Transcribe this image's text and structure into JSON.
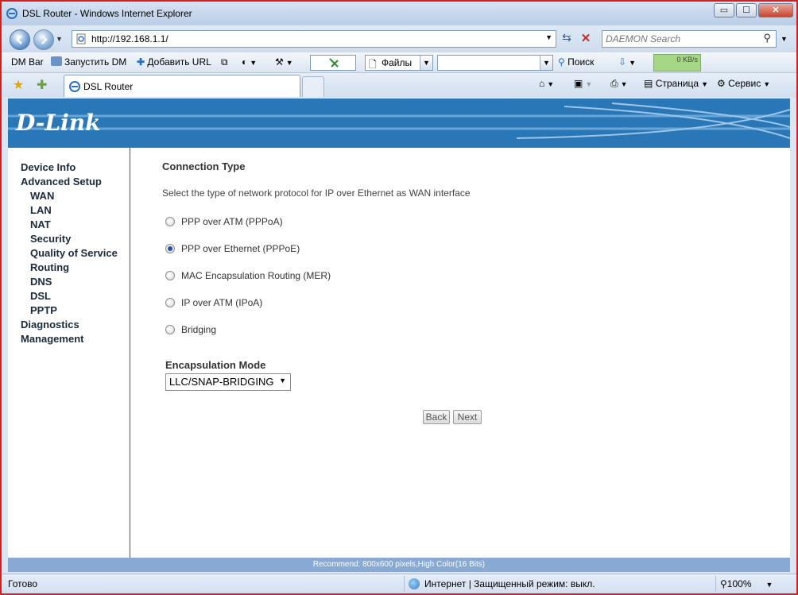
{
  "window": {
    "title": "DSL Router - Windows Internet Explorer",
    "controls": {
      "minimize": "▭",
      "maximize": "☐",
      "close": "✕"
    }
  },
  "address_bar": {
    "url": "http://192.168.1.1/",
    "search_placeholder": "DAEMON Search"
  },
  "dm_bar": {
    "label": "DM Bar",
    "launch": "Запустить DM",
    "add_url": "Добавить URL",
    "files": "Файлы",
    "search": "Поиск",
    "speed": "0 KB/s"
  },
  "tabs": {
    "active_tab": "DSL Router",
    "page_menu": "Страница",
    "tools_menu": "Сервис"
  },
  "banner": {
    "logo": "D-Link"
  },
  "sidebar": {
    "items": [
      {
        "label": "Device Info",
        "level": 0
      },
      {
        "label": "Advanced Setup",
        "level": 0
      },
      {
        "label": "WAN",
        "level": 1
      },
      {
        "label": "LAN",
        "level": 1
      },
      {
        "label": "NAT",
        "level": 1
      },
      {
        "label": "Security",
        "level": 1
      },
      {
        "label": "Quality of Service",
        "level": 1
      },
      {
        "label": "Routing",
        "level": 1
      },
      {
        "label": "DNS",
        "level": 1
      },
      {
        "label": "DSL",
        "level": 1
      },
      {
        "label": "PPTP",
        "level": 1
      },
      {
        "label": "Diagnostics",
        "level": 0
      },
      {
        "label": "Management",
        "level": 0
      }
    ]
  },
  "main": {
    "heading": "Connection Type",
    "description": "Select the type of network protocol for IP over Ethernet as WAN interface",
    "options": [
      {
        "label": "PPP over ATM (PPPoA)",
        "selected": false
      },
      {
        "label": "PPP over Ethernet (PPPoE)",
        "selected": true
      },
      {
        "label": "MAC Encapsulation Routing (MER)",
        "selected": false
      },
      {
        "label": "IP over ATM (IPoA)",
        "selected": false
      },
      {
        "label": "Bridging",
        "selected": false
      }
    ],
    "encapsulation_label": "Encapsulation Mode",
    "encapsulation_value": "LLC/SNAP-BRIDGING",
    "back_button": "Back",
    "next_button": "Next"
  },
  "footer": {
    "recommend": "Recommend: 800x600 pixels,High Color(16 Bits)"
  },
  "status_bar": {
    "status": "Готово",
    "zone": "Интернет | Защищенный режим: выкл.",
    "zoom": "100%"
  },
  "colors": {
    "banner_blue": "#2a77b8",
    "sidebar_divider": "#c41f2b",
    "footer_bar": "#87a9d4"
  }
}
